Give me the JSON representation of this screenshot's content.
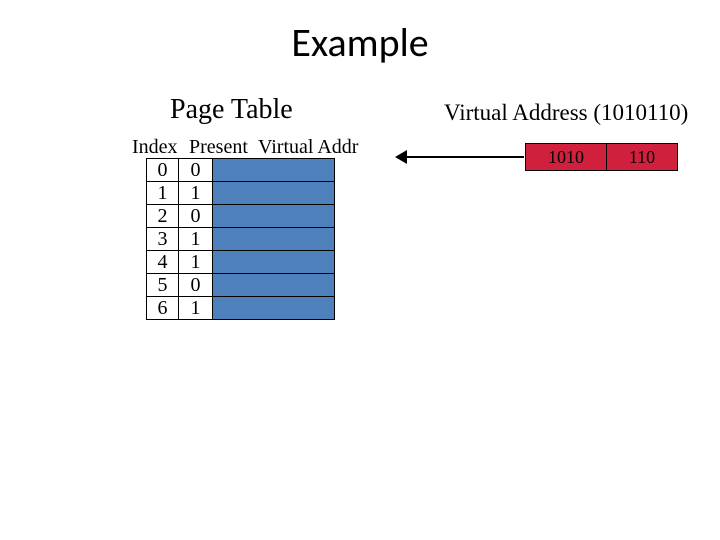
{
  "title": "Example",
  "left_heading": "Page Table",
  "right_heading": "Virtual Address (1010110)",
  "columns": {
    "index": "Index",
    "present": "Present",
    "vaddr": "Virtual Addr"
  },
  "rows": [
    {
      "index": "0",
      "present": "0"
    },
    {
      "index": "1",
      "present": "1"
    },
    {
      "index": "2",
      "present": "0"
    },
    {
      "index": "3",
      "present": "1"
    },
    {
      "index": "4",
      "present": "1"
    },
    {
      "index": "5",
      "present": "0"
    },
    {
      "index": "6",
      "present": "1"
    }
  ],
  "va": {
    "page": "1010",
    "offset": "110"
  }
}
